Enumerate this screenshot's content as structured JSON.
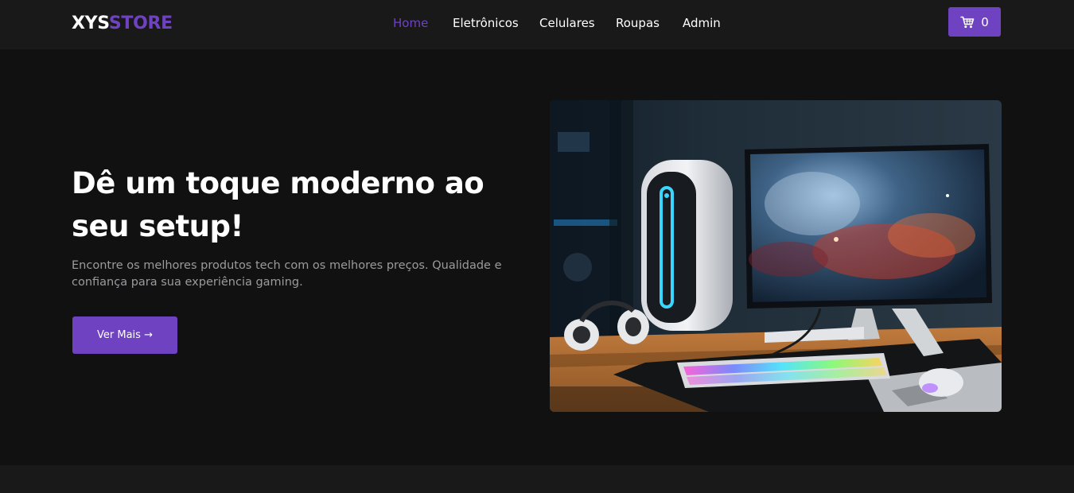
{
  "brand": {
    "logo_part1": "XYS",
    "logo_part2": "STORE",
    "accent_color": "#6f42c1"
  },
  "nav": {
    "links": [
      {
        "label": "Home",
        "active": true
      },
      {
        "label": "Eletrônicos",
        "active": false
      },
      {
        "label": "Celulares",
        "active": false
      },
      {
        "label": "Roupas",
        "active": false
      },
      {
        "label": "Admin",
        "active": false
      }
    ]
  },
  "cart": {
    "icon": "shopping-cart-icon",
    "count": "0"
  },
  "hero": {
    "title": "Dê um toque moderno ao seu setup!",
    "description": "Encontre os melhores produtos tech com os melhores preços. Qualidade e confiança para sua experiência gaming.",
    "cta_label": "Ver Mais →"
  },
  "colors": {
    "background": "#111112",
    "navbar": "#19191a",
    "muted_text": "#9b9b9e",
    "primary": "#6f42c1"
  }
}
